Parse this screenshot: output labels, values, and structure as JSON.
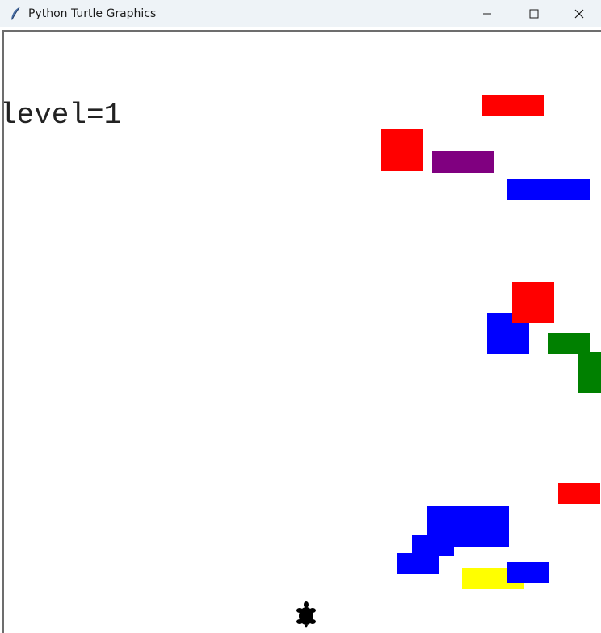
{
  "window": {
    "title": "Python Turtle Graphics",
    "icon": "feather-icon",
    "controls": [
      "minimize-icon",
      "maximize-icon",
      "close-icon"
    ]
  },
  "game": {
    "level_label": "level=1",
    "player": "turtle-icon",
    "colors": {
      "red": "#ff0000",
      "purple": "#800080",
      "blue": "#0000ff",
      "green": "#008000",
      "yellow": "#ffff00",
      "player": "#000000",
      "background": "#ffffff"
    }
  }
}
